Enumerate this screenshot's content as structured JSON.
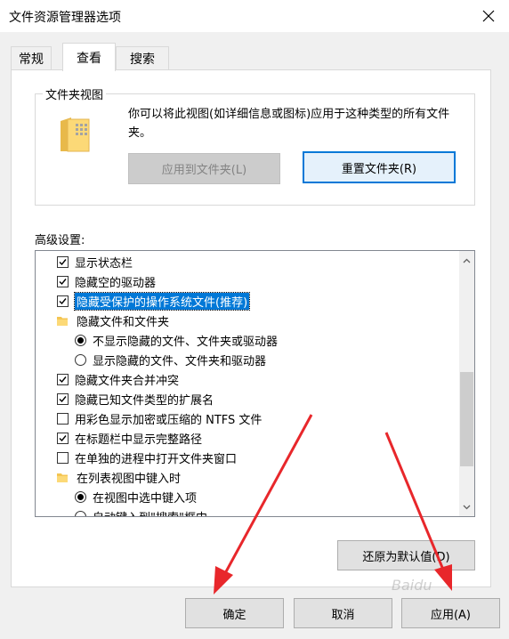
{
  "window": {
    "title": "文件资源管理器选项"
  },
  "tabs": [
    {
      "label": "常规"
    },
    {
      "label": "查看"
    },
    {
      "label": "搜索"
    }
  ],
  "folder_view": {
    "legend": "文件夹视图",
    "description": "你可以将此视图(如详细信息或图标)应用于这种类型的所有文件夹。",
    "apply_button": "应用到文件夹(L)",
    "reset_button": "重置文件夹(R)"
  },
  "advanced": {
    "label": "高级设置:",
    "items": [
      {
        "type": "checkbox",
        "checked": true,
        "label": "显示状态栏"
      },
      {
        "type": "checkbox",
        "checked": true,
        "label": "隐藏空的驱动器"
      },
      {
        "type": "checkbox",
        "checked": true,
        "label": "隐藏受保护的操作系统文件(推荐)",
        "selected": true
      },
      {
        "type": "folder",
        "label": "隐藏文件和文件夹"
      },
      {
        "type": "radio",
        "checked": true,
        "label": "不显示隐藏的文件、文件夹或驱动器"
      },
      {
        "type": "radio",
        "checked": false,
        "label": "显示隐藏的文件、文件夹和驱动器"
      },
      {
        "type": "checkbox",
        "checked": true,
        "label": "隐藏文件夹合并冲突"
      },
      {
        "type": "checkbox",
        "checked": true,
        "label": "隐藏已知文件类型的扩展名"
      },
      {
        "type": "checkbox",
        "checked": false,
        "label": "用彩色显示加密或压缩的 NTFS 文件"
      },
      {
        "type": "checkbox",
        "checked": true,
        "label": "在标题栏中显示完整路径"
      },
      {
        "type": "checkbox",
        "checked": false,
        "label": "在单独的进程中打开文件夹窗口"
      },
      {
        "type": "folder",
        "label": "在列表视图中键入时"
      },
      {
        "type": "radio",
        "checked": true,
        "label": "在视图中选中键入项"
      },
      {
        "type": "radio",
        "checked": false,
        "label": "自动键入到\"搜索\"框中"
      }
    ],
    "restore_button": "还原为默认值(D)"
  },
  "footer": {
    "ok": "确定",
    "cancel": "取消",
    "apply": "应用(A)"
  },
  "watermark": "Baidu",
  "colors": {
    "accent": "#0078d7",
    "arrow": "#e8272b"
  }
}
